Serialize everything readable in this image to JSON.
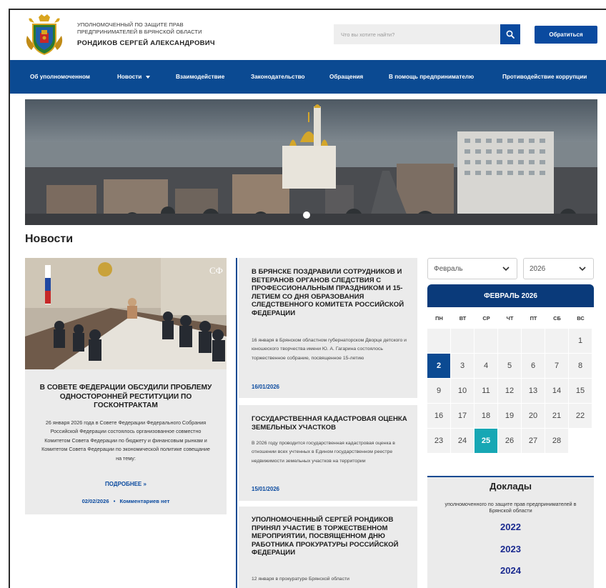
{
  "header": {
    "org_line1": "УПОЛНОМОЧЕННЫЙ ПО ЗАЩИТЕ ПРАВ",
    "org_line2": "ПРЕДПРИНИМАТЕЛЕЙ В БРЯНСКОЙ ОБЛАСТИ",
    "org_name": "РОНДИКОВ СЕРГЕЙ АЛЕКСАНДРОВИЧ",
    "search_placeholder": "Что вы хотите найти?",
    "contact_button": "Обратиться",
    "logo_icon": "coat-of-arms-icon",
    "search_icon": "search-icon"
  },
  "nav": [
    {
      "label": "Об уполномоченном"
    },
    {
      "label": "Новости"
    },
    {
      "label": "Взаимодействие"
    },
    {
      "label": "Законодательство"
    },
    {
      "label": "Обращения"
    },
    {
      "label": "В помощь предпринимателю"
    },
    {
      "label": "Противодействие коррупции"
    }
  ],
  "section_title": "Новости",
  "featured": {
    "title": "В СОВЕТЕ ФЕДЕРАЦИИ ОБСУДИЛИ ПРОБЛЕМУ ОДНОСТОРОННЕЙ РЕСТИТУЦИИ ПО ГОСКОНТРАКТАМ",
    "text": "26 января 2026 года в Совете Федерации Федерального Собрания Российской Федерации состоялось организованное совместно Комитетом Совета Федерации по бюджету и финансовым рынкам и Комитетом Совета Федерации по экономической политике совещание на тему:",
    "more": "ПОДРОБНЕЕ »",
    "date": "02/02/2026",
    "separator": "•",
    "comments": "Комментариев нет"
  },
  "news": [
    {
      "title": "В БРЯНСКЕ ПОЗДРАВИЛИ СОТРУДНИКОВ И ВЕТЕРАНОВ ОРГАНОВ СЛЕДСТВИЯ С ПРОФЕССИОНАЛЬНЫМ ПРАЗДНИКОМ И 15-ЛЕТИЕМ СО ДНЯ ОБРАЗОВАНИЯ СЛЕДСТВЕННОГО КОМИТЕТА РОССИЙСКОЙ ФЕДЕРАЦИИ",
      "text": "16 января в Брянском областном губернаторском Дворце детского и юношеского творчества имени Ю. А. Гагарина состоялось торжественное собрание, посвященное 15-летию",
      "date": "16/01/2026"
    },
    {
      "title": "ГОСУДАРСТВЕННАЯ КАДАСТРОВАЯ ОЦЕНКА ЗЕМЕЛЬНЫХ УЧАСТКОВ",
      "text": "В 2026 году проводится государственная кадастровая оценка в отношении всех учтенных в Едином государственном реестре недвижимости земельных участков на территории",
      "date": "15/01/2026"
    },
    {
      "title": "УПОЛНОМОЧЕННЫЙ СЕРГЕЙ РОНДИКОВ ПРИНЯЛ УЧАСТИЕ В ТОРЖЕСТВЕННОМ МЕРОПРИЯТИИ, ПОСВЯЩЕННОМ ДНЮ РАБОТНИКА ПРОКУРАТУРЫ РОССИЙСКОЙ ФЕДЕРАЦИИ",
      "text": "12 января в прокуратуре Брянской области"
    }
  ],
  "calendar": {
    "month_select": "Февраль",
    "year_select": "2026",
    "title": "ФЕВРАЛЬ 2026",
    "weekdays": [
      "ПН",
      "ВТ",
      "СР",
      "ЧТ",
      "ПТ",
      "СБ",
      "ВС"
    ],
    "days": [
      "1",
      "2",
      "3",
      "4",
      "5",
      "6",
      "7",
      "8",
      "9",
      "10",
      "11",
      "12",
      "13",
      "14",
      "15",
      "16",
      "17",
      "18",
      "19",
      "20",
      "21",
      "22",
      "23",
      "24",
      "25",
      "26",
      "27",
      "28"
    ],
    "selected_day": "2",
    "today": "25"
  },
  "reports": {
    "title": "Доклады",
    "subtitle": "уполномоченного по защите прав предпринимателей в Брянской области",
    "years": [
      "2022",
      "2023",
      "2024"
    ]
  },
  "colors": {
    "brand_blue": "#0b4a92",
    "link_blue": "#0a4a9f",
    "today_teal": "#17a7b4",
    "year_blue": "#1a2a8f"
  }
}
